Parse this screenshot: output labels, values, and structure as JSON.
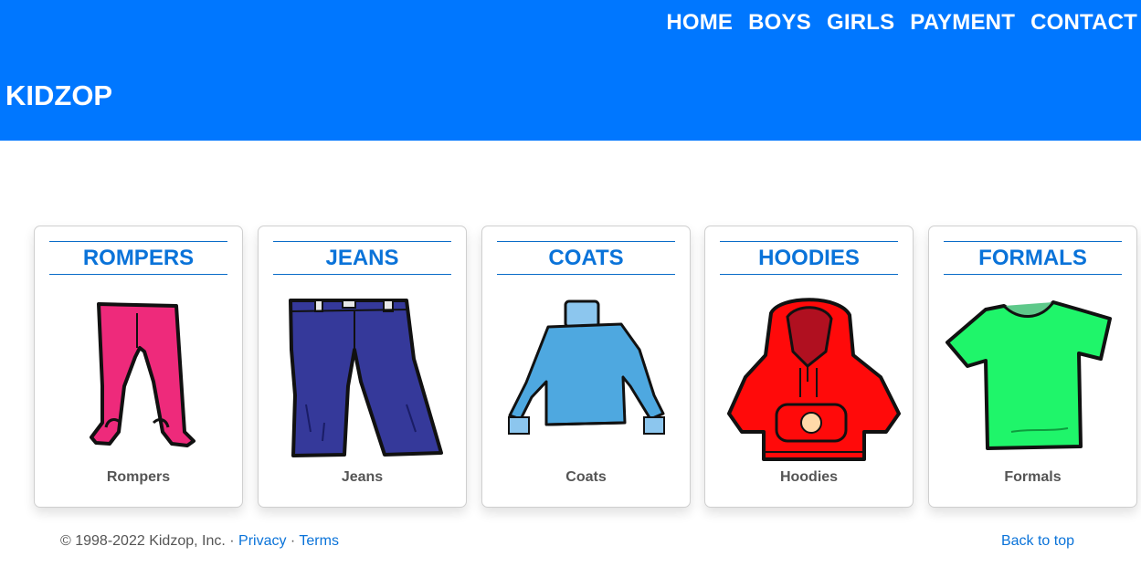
{
  "nav": {
    "home": "HOME",
    "boys": "BOYS",
    "girls": "GIRLS",
    "payment": "PAYMENT",
    "contact": "CONTACT"
  },
  "brand": "KIDZOP",
  "cards": [
    {
      "title": "ROMPERS",
      "caption": "Rompers",
      "image": "pink-romper-icon"
    },
    {
      "title": "JEANS",
      "caption": "Jeans",
      "image": "blue-jeans-icon"
    },
    {
      "title": "COATS",
      "caption": "Coats",
      "image": "light-blue-sweater-icon"
    },
    {
      "title": "HOODIES",
      "caption": "Hoodies",
      "image": "red-hoodie-icon"
    },
    {
      "title": "FORMALS",
      "caption": "Formals",
      "image": "green-tshirt-icon"
    }
  ],
  "footer": {
    "copyright": "© 1998-2022 Kidzop, Inc.",
    "sep1": " · ",
    "privacy": "Privacy",
    "sep2": " · ",
    "terms": "Terms",
    "back_to_top": "Back to top"
  },
  "colors": {
    "header_bg": "#0077ff",
    "accent": "#0a73d9",
    "romper": "#ee2a7b",
    "jeans": "#35399a",
    "coat": "#4ea8e0",
    "hoodie": "#ff0a0a",
    "tshirt": "#1ff56a"
  }
}
